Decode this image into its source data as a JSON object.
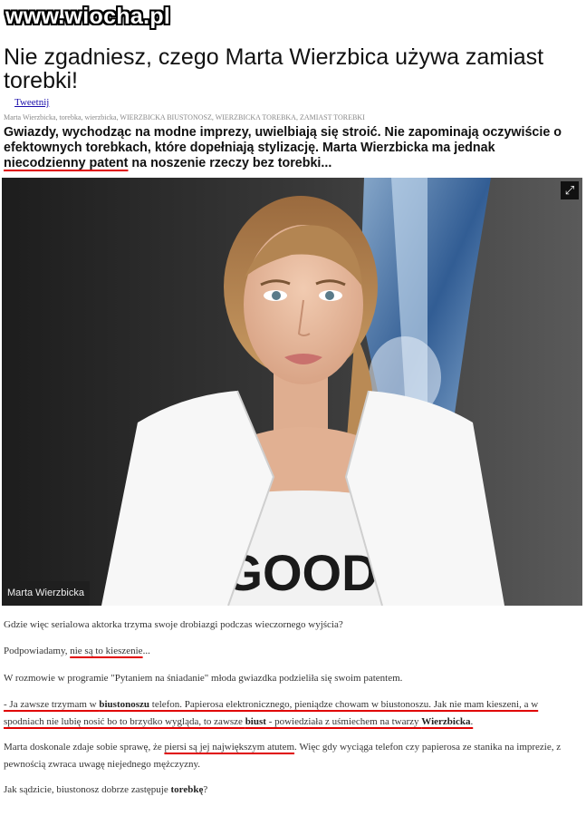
{
  "watermark": "www.wiocha.pl",
  "article": {
    "title": "Nie zgadniesz, czego Marta Wierzbica używa zamiast torebki!",
    "tweet_label": "Tweetnij",
    "tags": "Marta Wierzbicka, torebka, wierzbicka, WIERZBICKA BIUSTONOSZ, WIERZBICKA TOREBKA, ZAMIAST TOREBKI",
    "lead": {
      "part1": "Gwiazdy, wychodząc na modne imprezy, uwielbiają się stroić. Nie zapominają oczywiście o efektownych torebkach, które dopełniają stylizację. Marta Wierzbicka ma jednak ",
      "underlined": "niecodzienny patent",
      "part2": " na noszenie rzeczy bez torebki..."
    },
    "photo": {
      "caption": "Marta Wierzbicka",
      "expand_icon": "expand-arrows-icon",
      "shirt_text": "GOOD"
    },
    "p1": "Gdzie więc serialowa aktorka trzyma swoje drobiazgi podczas wieczornego wyjścia?",
    "p2": {
      "before": "Podpowiadamy, ",
      "underlined": "nie są to kieszenie",
      "after": "..."
    },
    "p3": "W rozmowie w programie \"Pytaniem na śniadanie\" młoda gwiazdka podzieliła się swoim patentem.",
    "p4": {
      "a": "- Ja zawsze trzymam w ",
      "b1": "biustonoszu",
      "c": " telefon. Papierosa elektronicznego, pieniądze chowam w biustonoszu. Jak nie mam kieszeni, a w spodniach nie lubię nosić bo to brzydko wygląda, to zawsze ",
      "b2": "biust",
      "d": " - powiedziała z uśmiechem na twarzy ",
      "b3": "Wierzbicka",
      "e": "."
    },
    "p5": {
      "before": "Marta doskonale zdaje sobie sprawę, że ",
      "underlined": "piersi są jej największym atutem",
      "after": ". Więc gdy wyciąga telefon czy papierosa ze stanika na imprezie, z pewnością zwraca uwagę niejednego mężczyzny."
    },
    "p6": {
      "before": "Jak sądzicie, biustonosz dobrze zastępuje ",
      "bold": "torebkę",
      "after": "?"
    }
  },
  "colors": {
    "link": "#1a0dab",
    "annotation": "#e00000"
  }
}
